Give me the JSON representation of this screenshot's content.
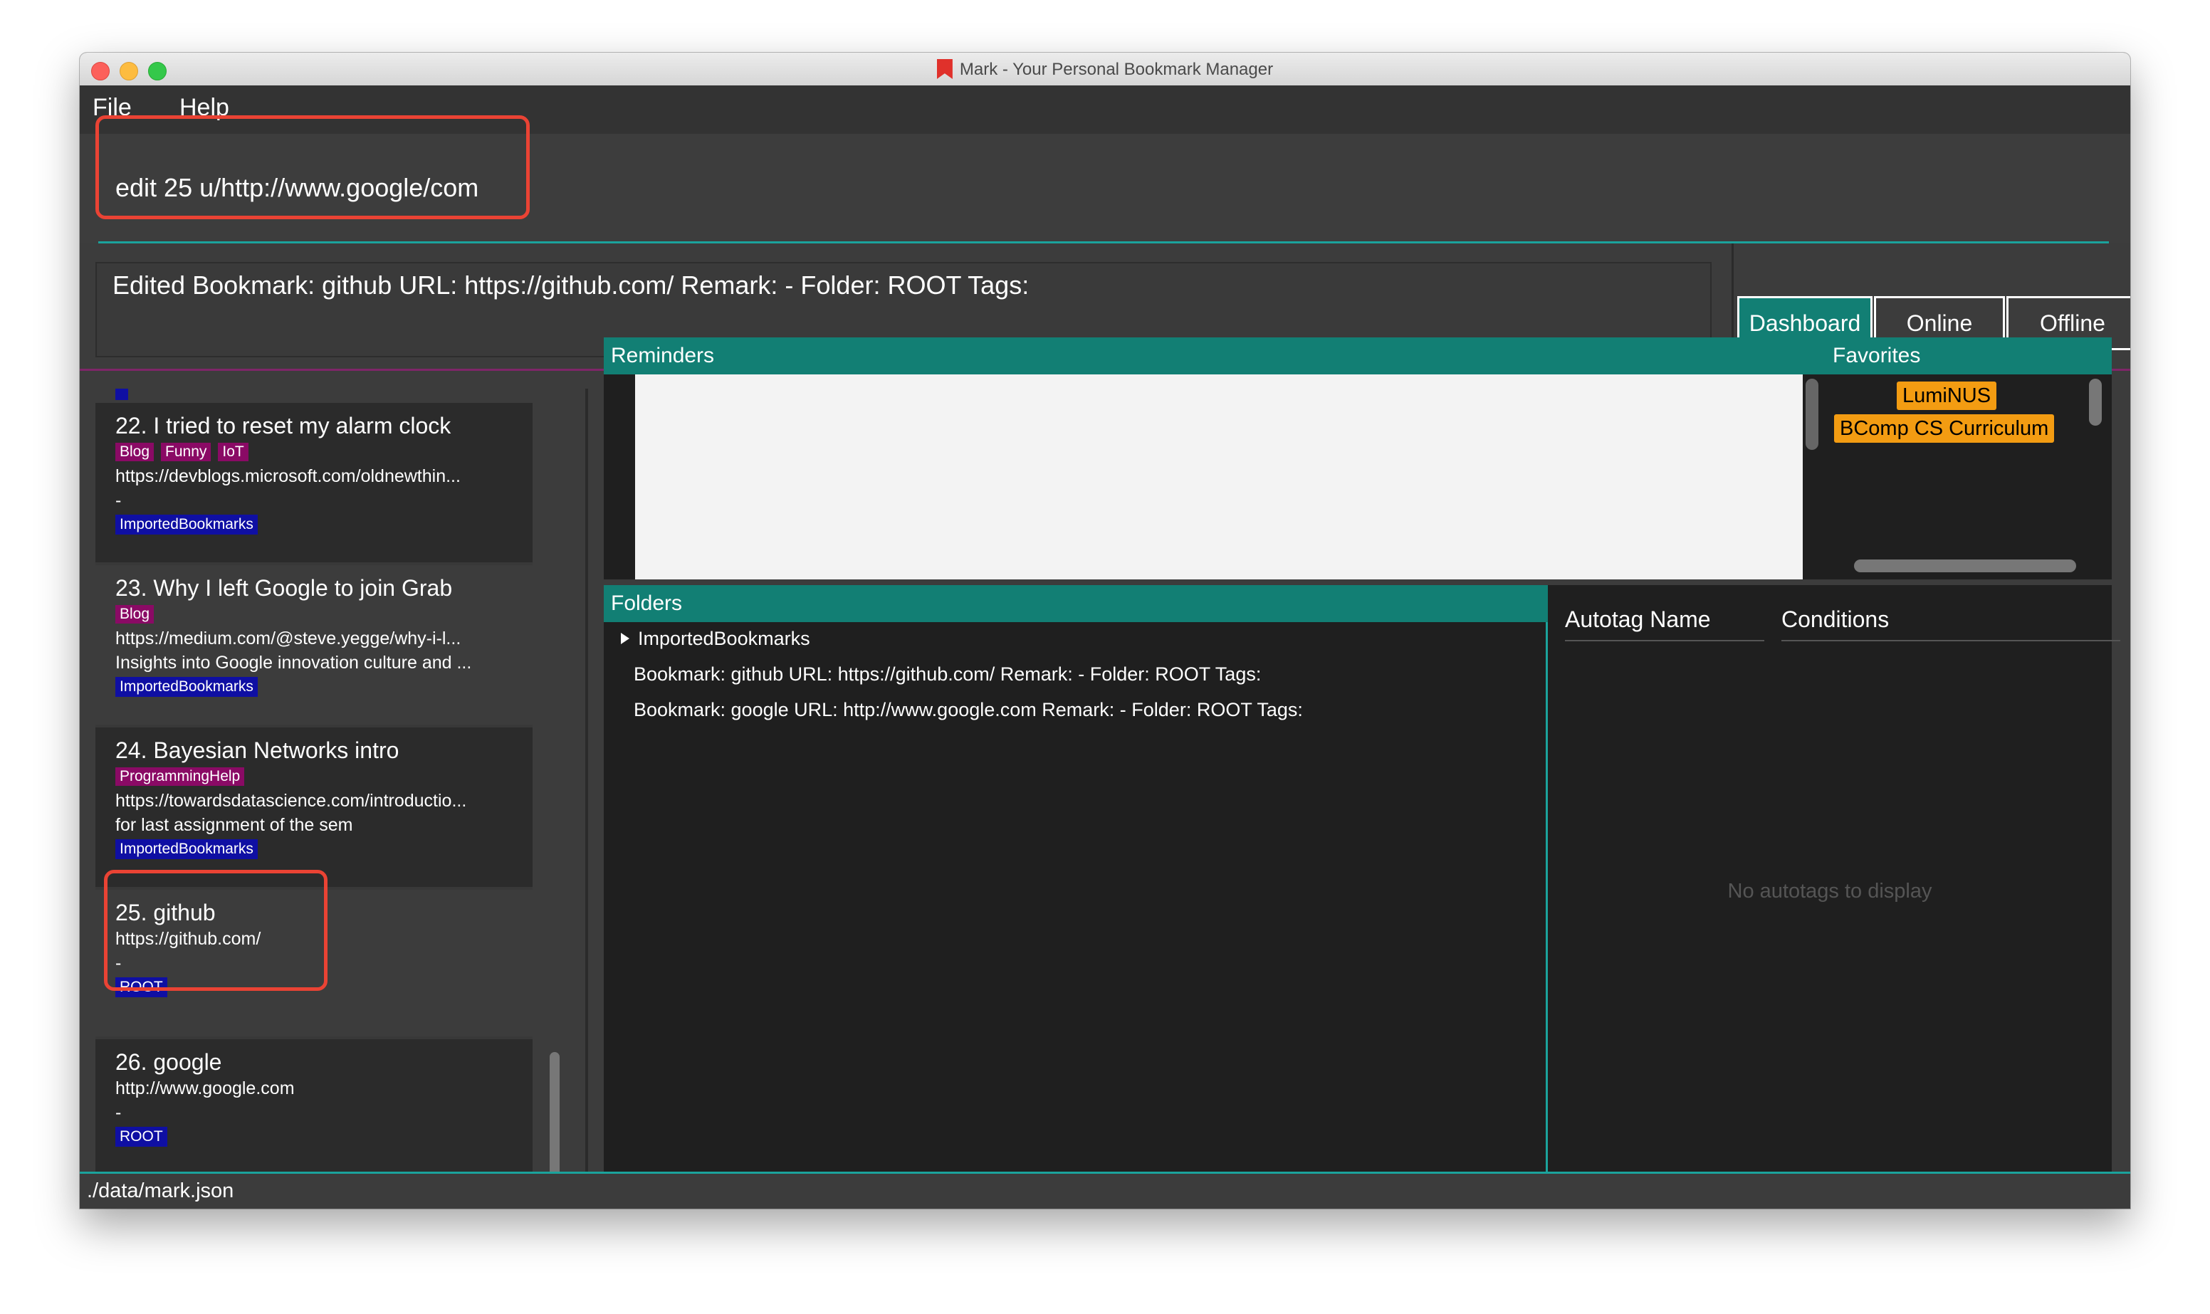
{
  "window": {
    "title": "Mark - Your Personal Bookmark Manager"
  },
  "menu": {
    "file": "File",
    "help": "Help"
  },
  "command": {
    "value": "edit 25 u/http://www.google/com"
  },
  "result": {
    "text": "Edited Bookmark: github URL: https://github.com/ Remark: - Folder: ROOT Tags:"
  },
  "modes": {
    "dashboard": "Dashboard",
    "online": "Online",
    "offline": "Offline",
    "active": "Dashboard"
  },
  "bookmarks": [
    {
      "title": "22.  I tried to reset my alarm clock",
      "tags": [
        "Blog",
        "Funny",
        "IoT"
      ],
      "url": "https://devblogs.microsoft.com/oldnewthin...",
      "remark": "-",
      "folder": "ImportedBookmarks"
    },
    {
      "title": "23.  Why I left Google to join Grab",
      "tags": [
        "Blog"
      ],
      "url": "https://medium.com/@steve.yegge/why-i-l...",
      "remark": "Insights into Google innovation culture and ...",
      "folder": "ImportedBookmarks"
    },
    {
      "title": "24.  Bayesian Networks intro",
      "tags": [
        "ProgrammingHelp"
      ],
      "url": "https://towardsdatascience.com/introductio...",
      "remark": "for last assignment of the sem",
      "folder": "ImportedBookmarks"
    },
    {
      "title": "25.  github",
      "tags": [],
      "url": "https://github.com/",
      "remark": "-",
      "folder": "ROOT"
    },
    {
      "title": "26.  google",
      "tags": [],
      "url": "http://www.google.com",
      "remark": "-",
      "folder": "ROOT"
    }
  ],
  "reminders": {
    "header": "Reminders"
  },
  "favorites": {
    "header": "Favorites",
    "items": [
      "LumiNUS",
      "BComp CS Curriculum"
    ]
  },
  "folders": {
    "header": "Folders",
    "root": "ImportedBookmarks",
    "items": [
      "Bookmark: github URL: https://github.com/ Remark: - Folder: ROOT Tags:",
      "Bookmark: google URL: http://www.google.com Remark: - Folder: ROOT Tags:"
    ]
  },
  "autotags": {
    "col_name": "Autotag Name",
    "col_conditions": "Conditions",
    "empty": "No autotags to display"
  },
  "status": {
    "path": "./data/mark.json"
  },
  "colors": {
    "accent": "#127f74",
    "highlight": "#ea4334",
    "tag": "#8a0a65",
    "folder_tag": "#0f0fa3",
    "favorite": "#f39c12"
  },
  "icons": {
    "app": "bookmark-icon",
    "expand": "triangle-right-icon"
  }
}
